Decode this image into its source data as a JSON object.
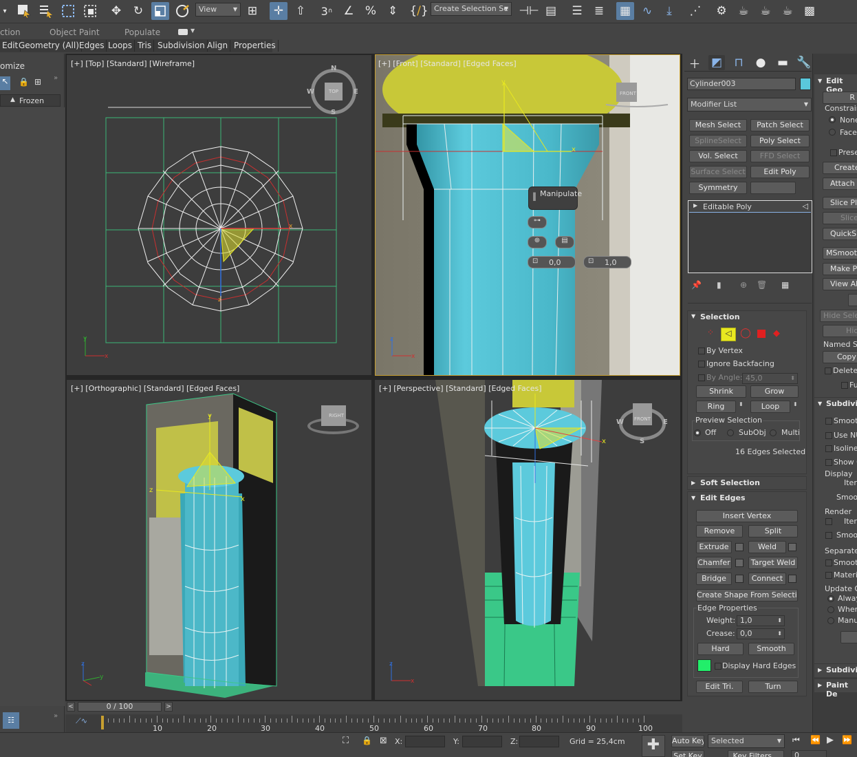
{
  "toolbar": {
    "view_dropdown": "View",
    "selection_set": "Create Selection Se",
    "icons": [
      "edit-menu-icon",
      "select-object-icon",
      "select-by-name-icon",
      "rect-selection-icon",
      "window-crossing-icon",
      "move-icon",
      "rotate-icon",
      "scale-icon",
      "placement-icon",
      "view-icon",
      "snaps-icon",
      "angle-snap-icon",
      "percent-snap-icon",
      "spinner-snap-icon",
      "named-selection-icon",
      "mirror-icon",
      "align-icon",
      "layer-explorer-icon",
      "scene-explorer-icon",
      "ribbon-icon",
      "curve-editor-icon",
      "schematic-icon",
      "material-editor-icon",
      "render-setup-icon",
      "render-frame-icon",
      "render-icon",
      "render-iterative-icon",
      "render-cloud-icon"
    ]
  },
  "ribbon": {
    "tabs": [
      "ction",
      "Object Paint",
      "Populate"
    ]
  },
  "menu": {
    "items": [
      "Edit",
      "Geometry (All)",
      "Edges",
      "Loops",
      "Tris",
      "Subdivision",
      "Align",
      "Properties"
    ]
  },
  "left_panel": {
    "title": "omize",
    "frozen": "Frozen"
  },
  "viewports": {
    "top": "[+] [Top] [Standard] [Wireframe]",
    "front": "[+] [Front] [Standard] [Edged Faces]",
    "ortho": "[+] [Orthographic] [Standard] [Edged Faces]",
    "persp": "[+] [Perspective] [Standard] [Edged Faces]",
    "compass": {
      "n": "N",
      "s": "S",
      "e": "E",
      "w": "W",
      "top": "TOP",
      "front": "FRONT",
      "right": "RIGHT"
    }
  },
  "manipulate": {
    "title": "Manipulate",
    "val1": "0,0",
    "val2": "1,0"
  },
  "command_panel": {
    "object_name": "Cylinder003",
    "object_color": "#5ac8dc",
    "modifier_list": "Modifier List",
    "modifier_buttons": [
      "Mesh Select",
      "Patch Select",
      "SplineSelect",
      "Poly Select",
      "Vol. Select",
      "FFD Select",
      "Surface Select",
      "Edit Poly",
      "Symmetry"
    ],
    "stack_item": "Editable Poly"
  },
  "selection": {
    "title": "Selection",
    "by_vertex": "By Vertex",
    "ignore_backfacing": "Ignore Backfacing",
    "by_angle": "By Angle:",
    "by_angle_val": "45,0",
    "shrink": "Shrink",
    "grow": "Grow",
    "ring": "Ring",
    "loop": "Loop",
    "preview": "Preview Selection",
    "off": "Off",
    "subobj": "SubObj",
    "multi": "Multi",
    "status": "16 Edges Selected"
  },
  "soft_selection": {
    "title": "Soft Selection"
  },
  "edit_edges": {
    "title": "Edit Edges",
    "insert_vertex": "Insert Vertex",
    "remove": "Remove",
    "split": "Split",
    "extrude": "Extrude",
    "weld": "Weld",
    "chamfer": "Chamfer",
    "target_weld": "Target Weld",
    "bridge": "Bridge",
    "connect": "Connect",
    "create_shape": "Create Shape From Selection",
    "edge_props": "Edge Properties",
    "weight": "Weight:",
    "weight_val": "1,0",
    "crease": "Crease:",
    "crease_val": "0,0",
    "hard": "Hard",
    "smooth": "Smooth",
    "display_hard": "Display Hard Edges",
    "hard_color": "#22ee6a",
    "edit_tri": "Edit Tri.",
    "turn": "Turn"
  },
  "edit_geometry": {
    "title": "Edit Geo",
    "repeat": "R",
    "constraints": "Constrain",
    "none": "None",
    "face": "Face",
    "preserve": "Prese",
    "create": "Create",
    "attach": "Attach",
    "slice_plane": "Slice Plan",
    "slice": "Slice",
    "quickslice": "QuickSli",
    "msmooth": "MSmooth",
    "make_planar": "Make Pl",
    "view_align": "View Ali",
    "hide_sel": "Hide Selec",
    "hide": "Hid",
    "named_sel": "Named Se",
    "copy": "Copy",
    "delete": "Delete",
    "fu": "Fu"
  },
  "subdivision": {
    "title": "Subdivis",
    "smooth": "Smoot",
    "use_nu": "Use NU",
    "isoline": "Isoline",
    "show": "Show C",
    "display": "Display",
    "iter": "Iter",
    "smoot2": "Smoot",
    "render": "Render",
    "iter2": "Iter",
    "smoot3": "Smoot",
    "separate": "Separate",
    "smooth2": "Smoot",
    "materia": "Materia",
    "update": "Update O",
    "always": "Alway",
    "when": "When",
    "manual": "Manu"
  },
  "subdiv2": {
    "title": "Subdivis"
  },
  "paint_def": {
    "title": "Paint De"
  },
  "timeline": {
    "frame": "0 / 100",
    "ticks": [
      "10",
      "20",
      "30",
      "40",
      "50",
      "60",
      "70",
      "80",
      "90",
      "100"
    ]
  },
  "status": {
    "x_label": "X:",
    "y_label": "Y:",
    "z_label": "Z:",
    "grid": "Grid = 25,4cm",
    "auto_key": "Auto Key",
    "set_key": "Set Key",
    "selected": "Selected",
    "key_filters": "Key Filters...",
    "key_val": "0"
  }
}
